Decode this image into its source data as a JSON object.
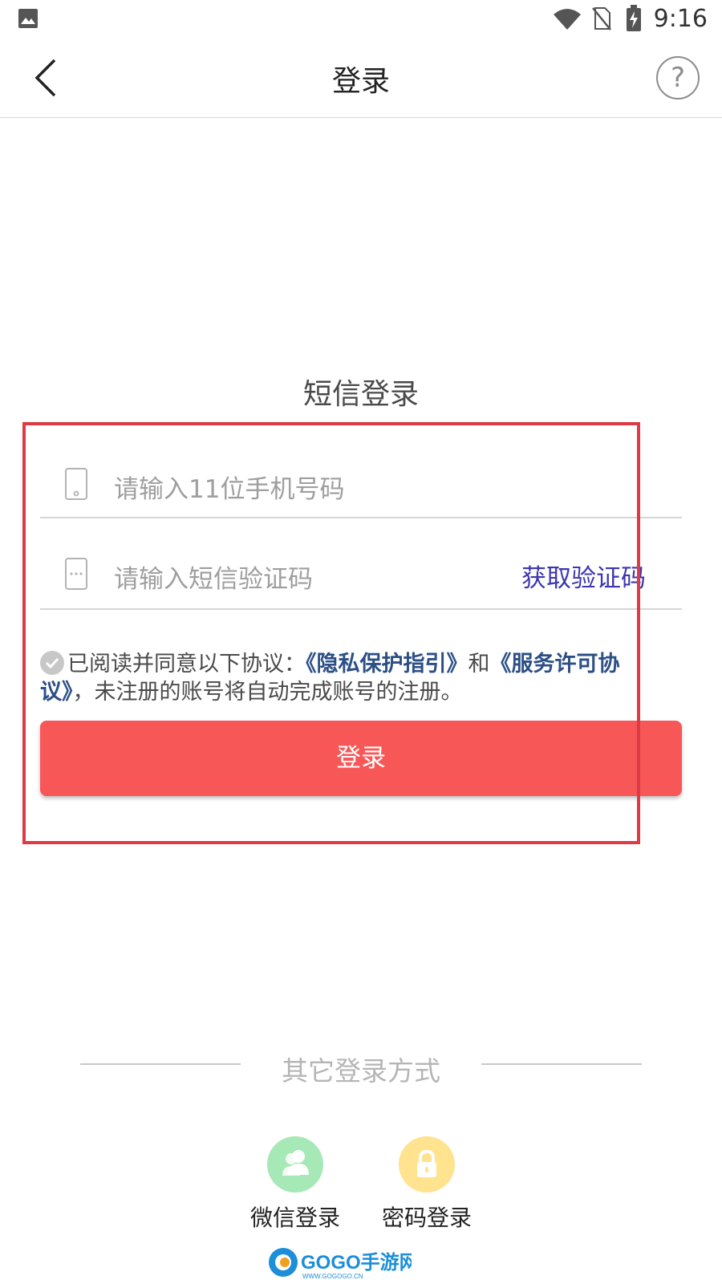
{
  "status_bar": {
    "time": "9:16"
  },
  "header": {
    "title": "登录"
  },
  "main": {
    "sms_title": "短信登录",
    "phone_placeholder": "请输入11位手机号码",
    "code_placeholder": "请输入短信验证码",
    "get_code_label": "获取验证码",
    "agreement": {
      "prefix": "已阅读并同意以下协议：",
      "privacy_link": "《隐私保护指引》",
      "conjunction": "和",
      "service_link": "《服务许可协议》",
      "suffix": "，未注册的账号将自动完成账号的注册。"
    },
    "login_button": "登录"
  },
  "other_login": {
    "title": "其它登录方式",
    "wechat_label": "微信登录",
    "password_label": "密码登录"
  },
  "watermark": {
    "text": "GOGO手游网",
    "url_text": "WWW.GOGOGO.CN"
  },
  "colors": {
    "accent_red": "#f75757",
    "highlight_red": "#de3a45",
    "link_blue": "#2c4f86",
    "code_blue": "#3c36b0",
    "wechat_green": "#a6e8b6",
    "password_yellow": "#ffe38e"
  }
}
